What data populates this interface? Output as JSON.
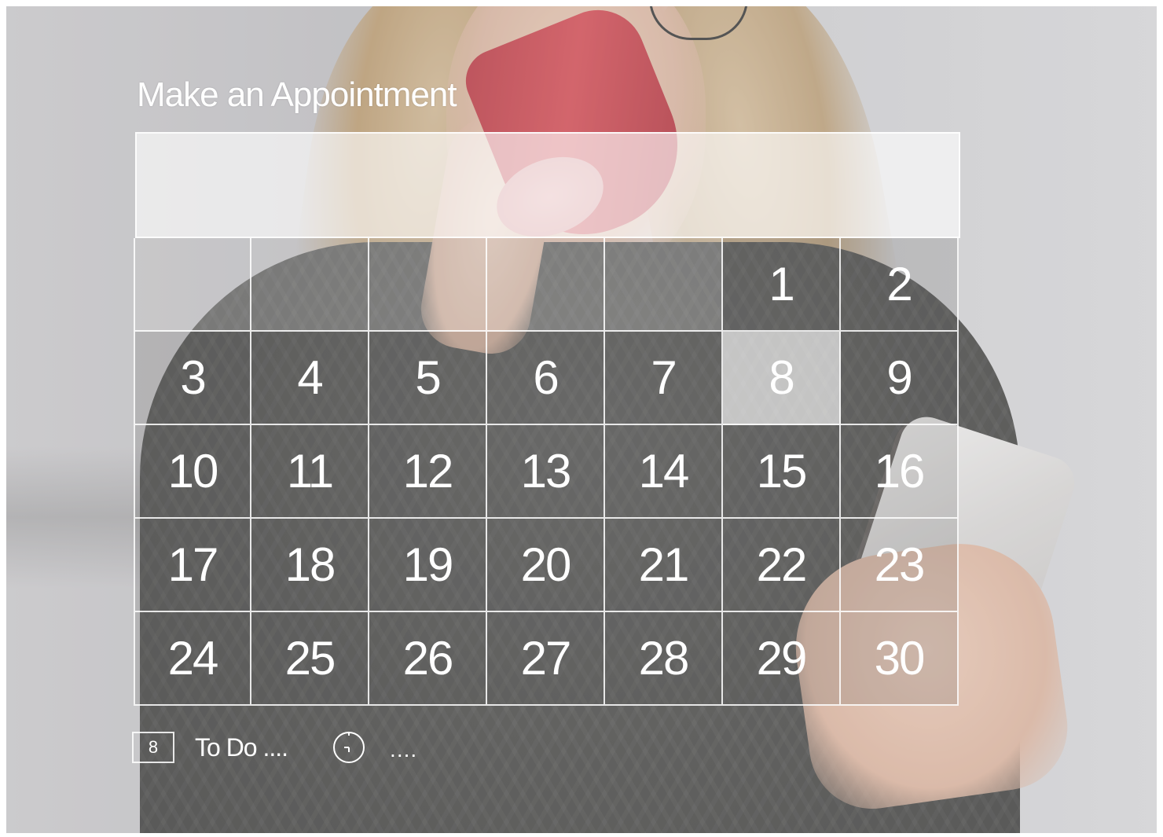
{
  "title": "Make an Appointment",
  "calendar": {
    "days": [
      "",
      "",
      "",
      "",
      "",
      "1",
      "2",
      "3",
      "4",
      "5",
      "6",
      "7",
      "8",
      "9",
      "10",
      "11",
      "12",
      "13",
      "14",
      "15",
      "16",
      "17",
      "18",
      "19",
      "20",
      "21",
      "22",
      "23",
      "24",
      "25",
      "26",
      "27",
      "28",
      "29",
      "30"
    ],
    "highlighted_day": "8"
  },
  "legend": {
    "box_label": "8",
    "todo_label": "To Do ....",
    "time_label": "....",
    "icon": "clock-icon"
  }
}
